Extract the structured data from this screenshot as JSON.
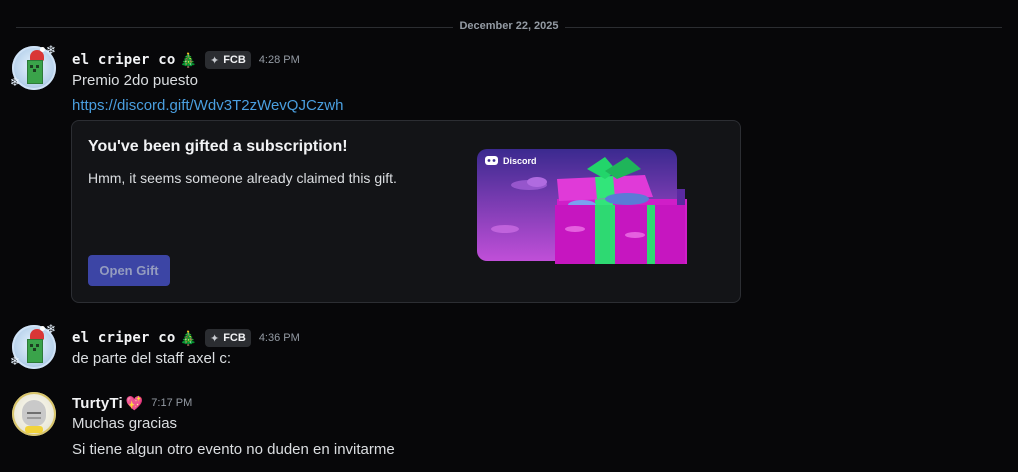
{
  "divider": {
    "date": "December 22, 2025"
  },
  "messages": [
    {
      "username": "el criper co",
      "tag": "FCB",
      "time": "4:28 PM",
      "lines": [
        "Premio 2do puesto"
      ],
      "link": "https://discord.gift/Wdv3T2zWevQJCzwh"
    },
    {
      "username": "el criper co",
      "tag": "FCB",
      "time": "4:36 PM",
      "lines": [
        "de parte del staff axel c:"
      ]
    },
    {
      "username": "TurtyTi",
      "time": "7:17 PM",
      "lines": [
        "Muchas gracias",
        "Si tiene algun otro evento no duden en invitarme"
      ]
    }
  ],
  "gift": {
    "title": "You've been gifted a subscription!",
    "subtitle": "Hmm, it seems someone already claimed this gift.",
    "button": "Open Gift",
    "art_brand": "Discord"
  },
  "colors": {
    "background": "#070709",
    "link": "#4a9fe0",
    "button": "#3c45a5",
    "gift_art_top": "#3b2a8f",
    "gift_art_bottom": "#c04fd8"
  },
  "icons": {
    "tree": "christmas-tree",
    "heart": "sparkle-heart",
    "tag": "guild-tag-diamond"
  }
}
